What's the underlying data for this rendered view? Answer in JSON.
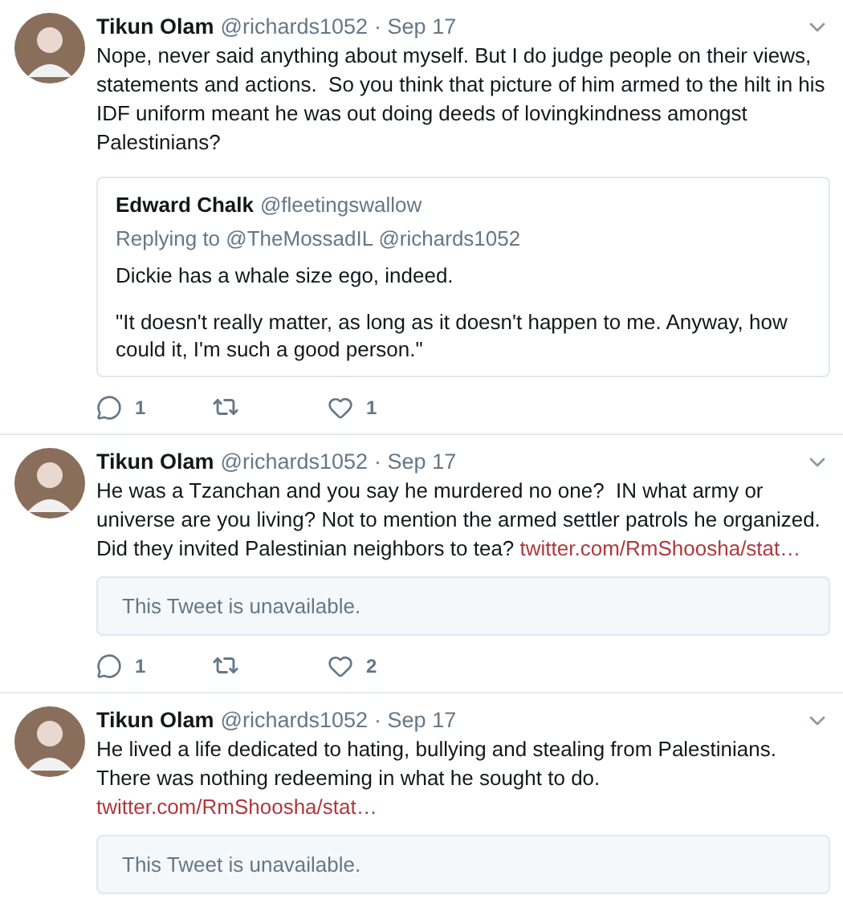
{
  "tweets": [
    {
      "name": "Tikun Olam",
      "handle": "@richards1052",
      "date": "· Sep 17",
      "text": "Nope, never said anything about myself. But I do judge people on their views, statements and actions.  So you think that picture of him armed to the hilt in his IDF uniform meant he was out doing deeds of lovingkindness amongst Palestinians?",
      "embed": {
        "kind": "quote",
        "name": "Edward Chalk",
        "handle": "@fleetingswallow",
        "replying": "Replying to @TheMossadIL @richards1052",
        "paragraphs": [
          "Dickie has a whale size ego, indeed.",
          "\"It doesn't really matter, as long as it doesn't happen to me. Anyway, how could it, I'm such a good person.\""
        ]
      },
      "actions": {
        "replies": "1",
        "likes": "1"
      }
    },
    {
      "name": "Tikun Olam",
      "handle": "@richards1052",
      "date": "· Sep 17",
      "text": "He was a Tzanchan and you say he murdered no one?  IN what army or universe are you living? Not to mention the armed settler patrols he organized. Did they invited Palestinian neighbors to tea?",
      "link": "twitter.com/RmShoosha/stat…",
      "embed": {
        "kind": "unavailable",
        "message": "This Tweet is unavailable."
      },
      "actions": {
        "replies": "1",
        "likes": "2"
      }
    },
    {
      "name": "Tikun Olam",
      "handle": "@richards1052",
      "date": "· Sep 17",
      "text": "He lived a life dedicated to hating, bullying and stealing from Palestinians. There was nothing redeeming in what he sought to do.",
      "link": "twitter.com/RmShoosha/stat…",
      "embed": {
        "kind": "unavailable",
        "message": "This Tweet is unavailable."
      }
    }
  ]
}
